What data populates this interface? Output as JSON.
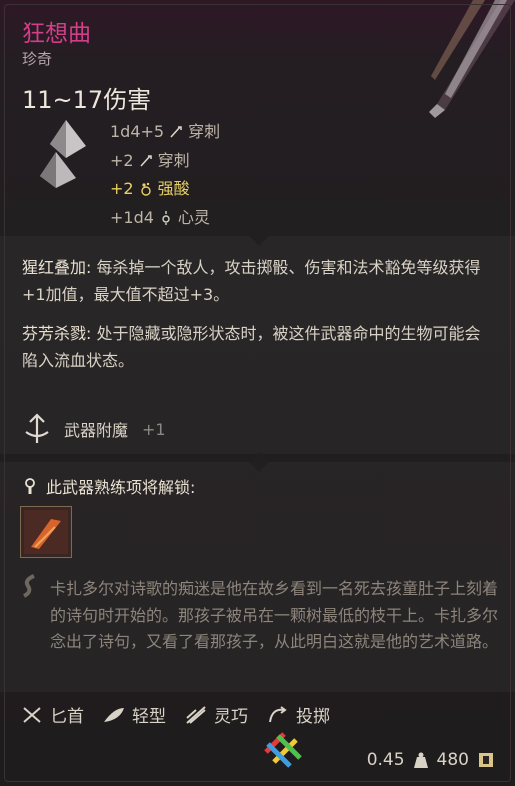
{
  "item": {
    "name": "狂想曲",
    "rarity": "珍奇",
    "damage": "11~17伤害",
    "name_color": "#d23e8a"
  },
  "damage_lines": [
    {
      "amount": "1d4+5",
      "icon": "piercing-icon",
      "type": "穿刺"
    },
    {
      "amount": "+2",
      "icon": "piercing-icon",
      "type": "穿刺"
    },
    {
      "amount": "+2",
      "icon": "acid-icon",
      "type": "强酸"
    },
    {
      "amount": "+1d4",
      "icon": "psychic-icon",
      "type": "心灵"
    }
  ],
  "passives": {
    "p1_label": "猩红叠加:",
    "p1_text": " 每杀掉一个敌人，攻击掷骰、伤害和法术豁免等级获得+1加值，最大值不超过+3。",
    "p2_label": "芬芳杀戮:",
    "p2_text": " 处于隐藏或隐形状态时，被这件武器命中的生物可能会陷入流血状态。"
  },
  "enchantment": {
    "label": "武器附魔",
    "value": "+1",
    "icon": "enchant-icon"
  },
  "proficiency": {
    "label": "此武器熟练项将解锁:",
    "icon": "lock-icon",
    "skill_icon": "skill-icon"
  },
  "lore": "卡扎多尔对诗歌的痴迷是他在故乡看到一名死去孩童肚子上刻着的诗句时开始的。那孩子被吊在一颗树最低的枝干上。卡扎多尔念出了诗句，又看了看那孩子，从此明白这就是他的艺术道路。",
  "properties": [
    {
      "icon": "dagger-icon",
      "label": "匕首"
    },
    {
      "icon": "feather-icon",
      "label": "轻型"
    },
    {
      "icon": "finesse-icon",
      "label": "灵巧"
    },
    {
      "icon": "thrown-icon",
      "label": "投掷"
    }
  ],
  "footer": {
    "weight": "0.45",
    "price": "480",
    "weight_icon": "weight-icon",
    "price_icon": "gold-icon"
  }
}
